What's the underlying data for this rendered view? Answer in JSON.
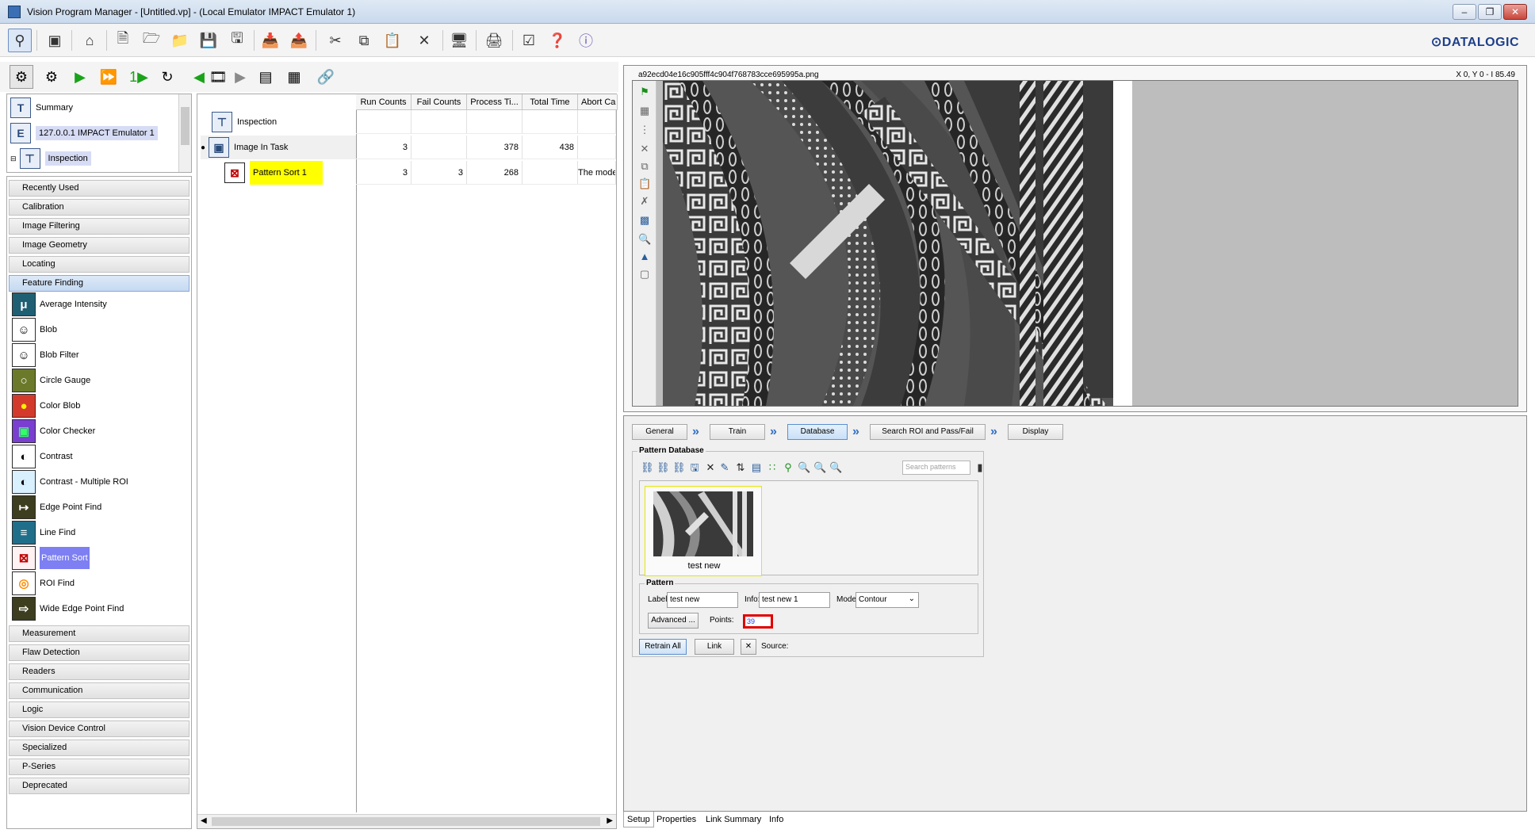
{
  "window": {
    "title": "Vision Program Manager - [Untitled.vp] - (Local Emulator IMPACT Emulator 1)",
    "brand": "⊙DATALOGIC"
  },
  "toolbar_icons": [
    "connect-icon",
    "stop-icon",
    "home-icon",
    "new-icon",
    "open-icon",
    "folder-icon",
    "save-icon",
    "save-as-icon",
    "import-icon",
    "export-icon",
    "cut-icon",
    "copy-icon",
    "paste-icon",
    "delete-icon",
    "monitor-icon",
    "print-icon",
    "checklist-icon",
    "help-icon",
    "about-icon"
  ],
  "run_toolbar_icons": [
    "inspection-mode-icon",
    "settings-icon",
    "run-icon",
    "run-one-icon",
    "step-icon",
    "loop-icon",
    "prev-image-icon",
    "film-icon",
    "next-image-icon",
    "sequence-icon",
    "grid-icon",
    "link-icon"
  ],
  "tree": {
    "items": [
      {
        "label": "Summary",
        "icon": "T"
      },
      {
        "label": "127.0.0.1 IMPACT Emulator 1",
        "icon": "E"
      },
      {
        "label": "Inspection",
        "icon": "⊤"
      }
    ]
  },
  "categories_top": [
    "Recently Used",
    "Calibration",
    "Image Filtering",
    "Image Geometry",
    "Locating",
    "Feature Finding"
  ],
  "tools": [
    {
      "label": "Average Intensity",
      "icon": "μ",
      "bg": "#1f5f73",
      "fg": "#ffffff"
    },
    {
      "label": "Blob",
      "icon": "☺",
      "bg": "#ffffff",
      "fg": "#000000"
    },
    {
      "label": "Blob Filter",
      "icon": "☺",
      "bg": "#ffffff",
      "fg": "#000000"
    },
    {
      "label": "Circle Gauge",
      "icon": "○",
      "bg": "#6b7a2a",
      "fg": "#ffffff"
    },
    {
      "label": "Color Blob",
      "icon": "●",
      "bg": "#d33a2b",
      "fg": "#ffee00"
    },
    {
      "label": "Color Checker",
      "icon": "▣",
      "bg": "#7a3fd0",
      "fg": "#33ff66"
    },
    {
      "label": "Contrast",
      "icon": "◐",
      "bg": "#ffffff",
      "fg": "#000000"
    },
    {
      "label": "Contrast - Multiple ROI",
      "icon": "◐",
      "bg": "#d9f0ff",
      "fg": "#000000"
    },
    {
      "label": "Edge Point Find",
      "icon": "↦",
      "bg": "#3d3d1f",
      "fg": "#ffffff"
    },
    {
      "label": "Line Find",
      "icon": "≡",
      "bg": "#1f6f8a",
      "fg": "#ffffff"
    },
    {
      "label": "Pattern Sort",
      "icon": "⊠",
      "bg": "#fff2f2",
      "fg": "#c00000"
    },
    {
      "label": "ROI Find",
      "icon": "◎",
      "bg": "#ffffff",
      "fg": "#ff8a00"
    },
    {
      "label": "Wide Edge Point Find",
      "icon": "⇨",
      "bg": "#3d3d1f",
      "fg": "#ffffff"
    }
  ],
  "categories_bottom": [
    "Measurement",
    "Flaw Detection",
    "Readers",
    "Communication",
    "Logic",
    "Vision Device Control",
    "Specialized",
    "P-Series",
    "Deprecated"
  ],
  "grid": {
    "columns": [
      "Run Counts",
      "Fail Counts",
      "Process Ti...",
      "Total Time",
      "Abort Ca"
    ],
    "rows": [
      {
        "name": "Inspection",
        "values": [
          "",
          "",
          "",
          "",
          ""
        ]
      },
      {
        "name": "Image In Task",
        "values": [
          "3",
          "",
          "378",
          "438",
          ""
        ]
      },
      {
        "name": "Pattern Sort 1",
        "values": [
          "3",
          "3",
          "268",
          "",
          "The mode"
        ]
      }
    ]
  },
  "viewer": {
    "filename": "a92ecd04e16c905fff4c904f768783cce695995a.png",
    "coords": "X 0,  Y 0  -  I 85.49"
  },
  "steps": [
    "General",
    "Train",
    "Database",
    "Search ROI and Pass/Fail",
    "Display"
  ],
  "active_step": "Database",
  "pattern_database": {
    "label": "Pattern Database",
    "search_placeholder": "Search patterns",
    "thumbnail_label": "test new"
  },
  "pattern": {
    "group_label": "Pattern",
    "label_caption": "Label:",
    "label_value": "test new",
    "info_caption": "Info:",
    "info_value": "test new 1",
    "mode_caption": "Mode:",
    "mode_value": "Contour",
    "advanced_button": "Advanced ...",
    "points_caption": "Points:",
    "points_value": "39"
  },
  "actions": {
    "retrain_all": "Retrain All",
    "link": "Link",
    "source_caption": "Source:"
  },
  "bottom_tabs": [
    "Setup",
    "Properties",
    "Link Summary",
    "Info"
  ],
  "colors": {
    "selection_yellow": "#ffff00",
    "selection_purple": "#7d7ff2",
    "highlight_red": "#e00000",
    "step_arrow": "#2f6fc4"
  }
}
